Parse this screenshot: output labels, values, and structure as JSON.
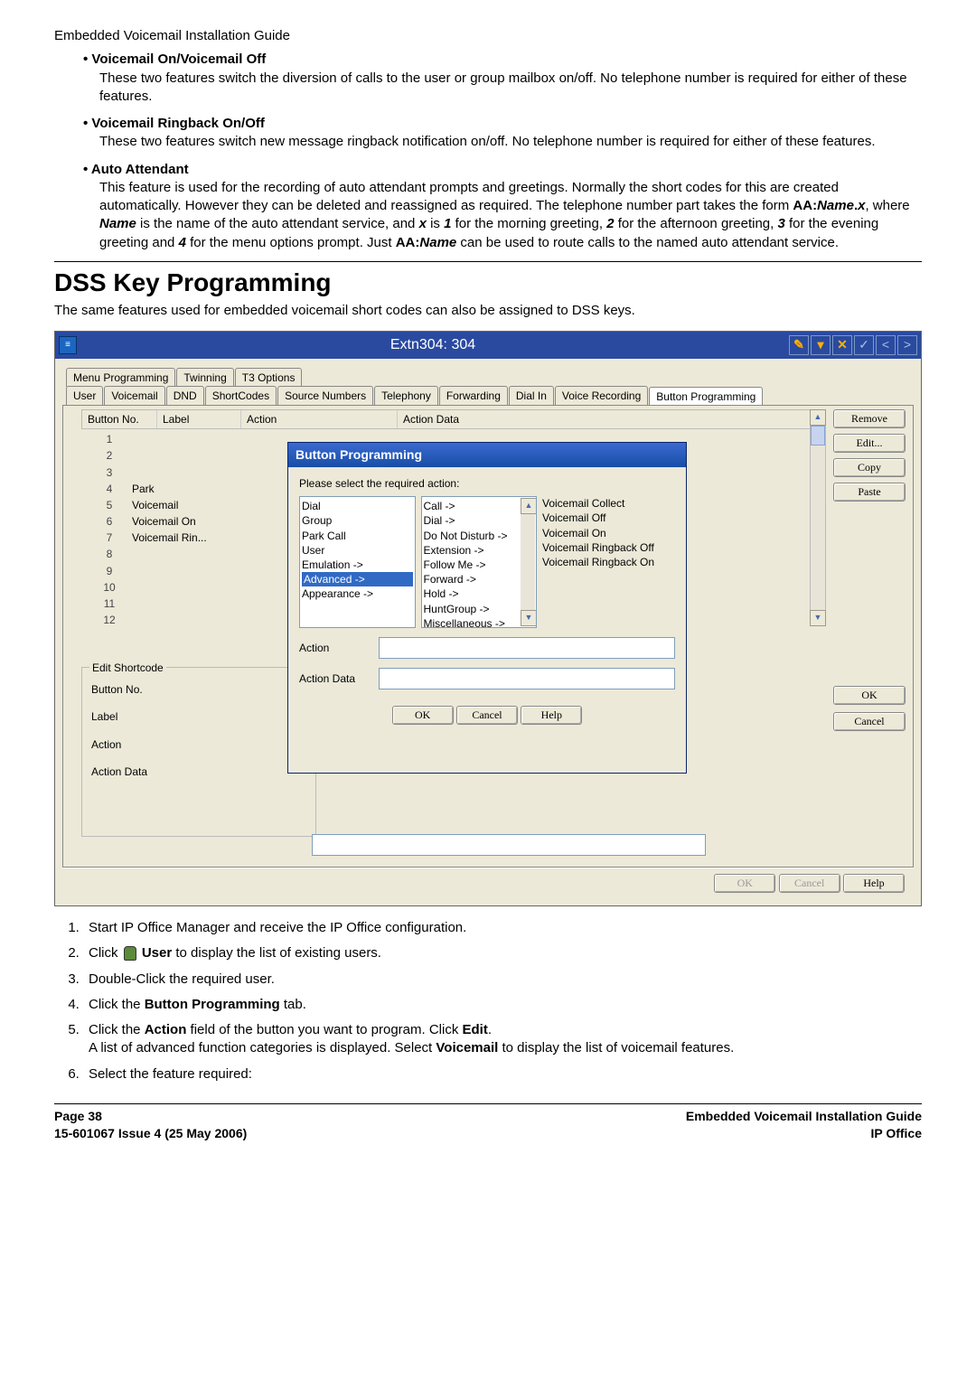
{
  "header": "Embedded Voicemail Installation Guide",
  "bullets": [
    {
      "title": "Voicemail On/Voicemail Off",
      "body": "These two features switch the diversion of calls to the user or group mailbox on/off. No telephone number is required for either of these features."
    },
    {
      "title": "Voicemail Ringback On/Off",
      "body": "These two features switch new message ringback notification on/off. No telephone number is required for either of these features."
    },
    {
      "title": "Auto Attendant",
      "body_html": "This feature is used for the recording of auto attendant prompts and greetings. Normally the short codes for this are created automatically. However they can be deleted and reassigned as required. The telephone number part takes the form <b>AA:<i>Name</i>.<i>x</i></b>, where <b><i>Name</i></b> is the name of the auto attendant service, and <b><i>x</i></b> is <b><i>1</i></b> for the morning greeting, <b><i>2</i></b> for the afternoon greeting, <b><i>3</i></b> for the evening greeting and <b><i>4</i></b> for the menu options prompt. Just <b>AA:<i>Name</i></b> can be used to route calls to the named auto attendant service."
    }
  ],
  "section_title": "DSS Key Programming",
  "section_intro": "The same features used for embedded voicemail short codes can also be assigned to DSS keys.",
  "window": {
    "title": "Extn304: 304",
    "tabs_row1": [
      "Menu Programming",
      "Twinning",
      "T3 Options"
    ],
    "tabs_row2": [
      "User",
      "Voicemail",
      "DND",
      "ShortCodes",
      "Source Numbers",
      "Telephony",
      "Forwarding",
      "Dial In",
      "Voice Recording",
      "Button Programming"
    ],
    "active_tab": "Button Programming",
    "table_headers": {
      "bn": "Button No.",
      "lb": "Label",
      "ac": "Action",
      "ad": "Action Data"
    },
    "rows": [
      {
        "n": "1",
        "l": ""
      },
      {
        "n": "2",
        "l": ""
      },
      {
        "n": "3",
        "l": ""
      },
      {
        "n": "4",
        "l": "Park"
      },
      {
        "n": "5",
        "l": "Voicemail"
      },
      {
        "n": "6",
        "l": "Voicemail On"
      },
      {
        "n": "7",
        "l": "Voicemail Rin..."
      },
      {
        "n": "8",
        "l": ""
      },
      {
        "n": "9",
        "l": ""
      },
      {
        "n": "10",
        "l": ""
      },
      {
        "n": "11",
        "l": ""
      },
      {
        "n": "12",
        "l": ""
      }
    ],
    "edit_shortcode": {
      "legend": "Edit Shortcode",
      "fields": [
        "Button No.",
        "Label",
        "Action",
        "Action Data"
      ]
    },
    "side_buttons": [
      "Remove",
      "Edit...",
      "Copy",
      "Paste"
    ],
    "side_ok": [
      "OK",
      "Cancel"
    ],
    "footer_buttons": [
      "OK",
      "Cancel",
      "Help"
    ]
  },
  "dialog": {
    "title": "Button Programming",
    "prompt": "Please select the required action:",
    "list1": [
      "Dial",
      "Group",
      "Park Call",
      "User",
      "Emulation ->",
      "Advanced ->",
      "Appearance ->"
    ],
    "list1_selected": "Advanced ->",
    "list2": [
      "Call ->",
      "Dial ->",
      "Do Not Disturb ->",
      "Extension ->",
      "Follow Me ->",
      "Forward ->",
      "Hold ->",
      "HuntGroup ->",
      "Miscellaneous ->"
    ],
    "list3": [
      "Voicemail Collect",
      "Voicemail Off",
      "Voicemail On",
      "Voicemail Ringback Off",
      "Voicemail Ringback On"
    ],
    "action_label": "Action",
    "action_data_label": "Action Data",
    "buttons": [
      "OK",
      "Cancel",
      "Help"
    ]
  },
  "steps": [
    "Start IP Office Manager and receive the IP Office configuration.",
    "Click ICON <b>User</b> to display the list of existing users.",
    "Double-Click the required user.",
    "Click the <b>Button Programming</b> tab.",
    "Click the <b>Action</b> field of the button you want to program. Click <b>Edit</b>.<br>A list of advanced function categories is displayed. Select <b>Voicemail</b> to display the list of voicemail features.",
    "Select the feature required:"
  ],
  "footer": {
    "page": "Page 38",
    "doc_id": "15-601067 Issue 4 (25 May 2006)",
    "right1": "Embedded Voicemail Installation Guide",
    "right2": "IP Office"
  }
}
